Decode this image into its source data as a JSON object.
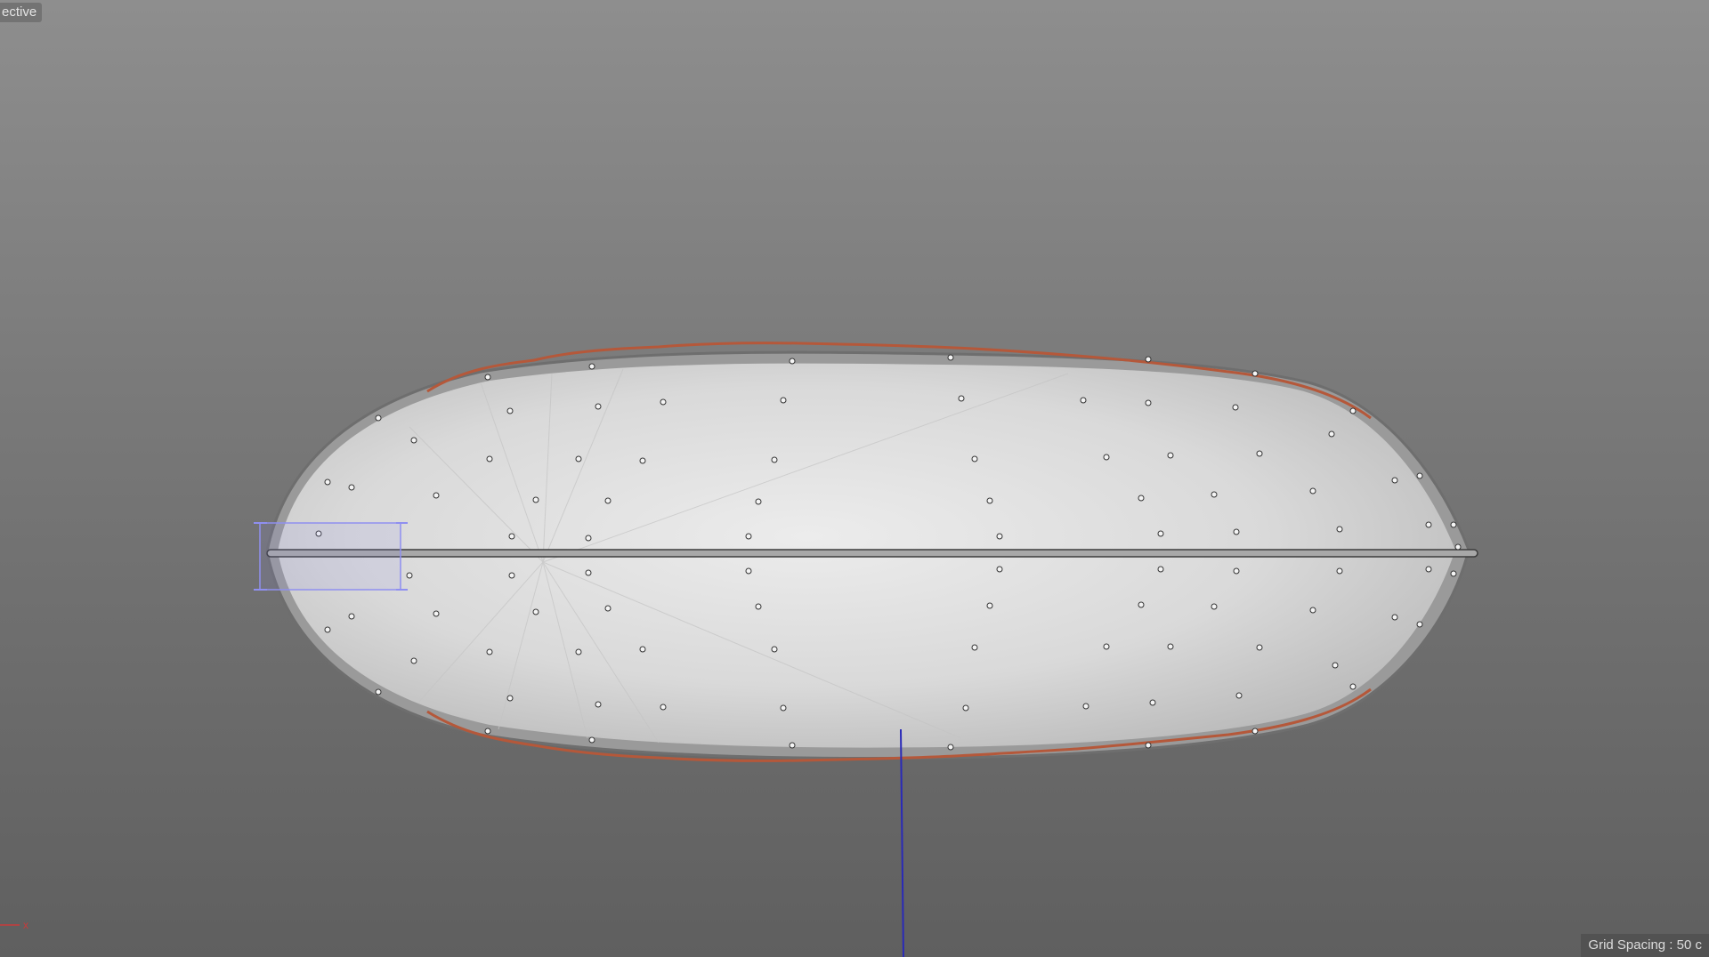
{
  "viewport": {
    "view_label": "ective",
    "grid_spacing_label": "Grid Spacing : 50 c",
    "axis_label": "x",
    "colors": {
      "background_top": "#8e8e8e",
      "background_bottom": "#5f5f5f",
      "mesh": "#d9d9d9",
      "edge_outline": "#b5583a",
      "selection_box": "#8f8ff0",
      "axis_blue": "#2a2ab8",
      "axis_red": "#c83a3a"
    },
    "object": {
      "name": "pillow-mesh",
      "selected_handle": "left-tip-selection"
    }
  }
}
